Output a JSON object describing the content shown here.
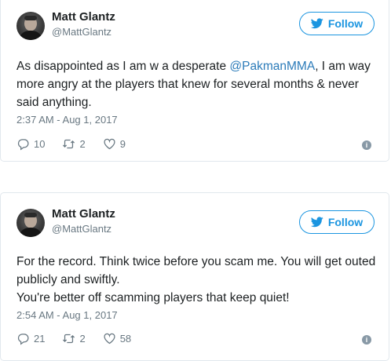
{
  "tweets": [
    {
      "author": {
        "name": "Matt Glantz",
        "handle": "@MattGlantz"
      },
      "follow_label": "Follow",
      "text": {
        "before_mention": "As disappointed as I am w a desperate ",
        "mention": "@PakmanMMA",
        "after_mention": ", I am way more angry at the players that knew for several months & never said anything."
      },
      "timestamp": "2:37 AM - Aug 1, 2017",
      "replies": "10",
      "retweets": "2",
      "likes": "9"
    },
    {
      "author": {
        "name": "Matt Glantz",
        "handle": "@MattGlantz"
      },
      "follow_label": "Follow",
      "text": {
        "line1": "For the record. Think twice before you scam me. You will get outed publicly and swiftly.",
        "line2": "You're better off scamming players that keep quiet!"
      },
      "timestamp": "2:54 AM - Aug 1, 2017",
      "replies": "21",
      "retweets": "2",
      "likes": "58"
    }
  ],
  "icons": {
    "follow": "bird-icon",
    "reply": "reply-icon",
    "retweet": "retweet-icon",
    "like": "heart-icon",
    "info": "info-icon"
  },
  "colors": {
    "accent": "#1b95e0",
    "mention": "#2b7bb9",
    "muted": "#697882",
    "border": "#e1e8ed"
  }
}
